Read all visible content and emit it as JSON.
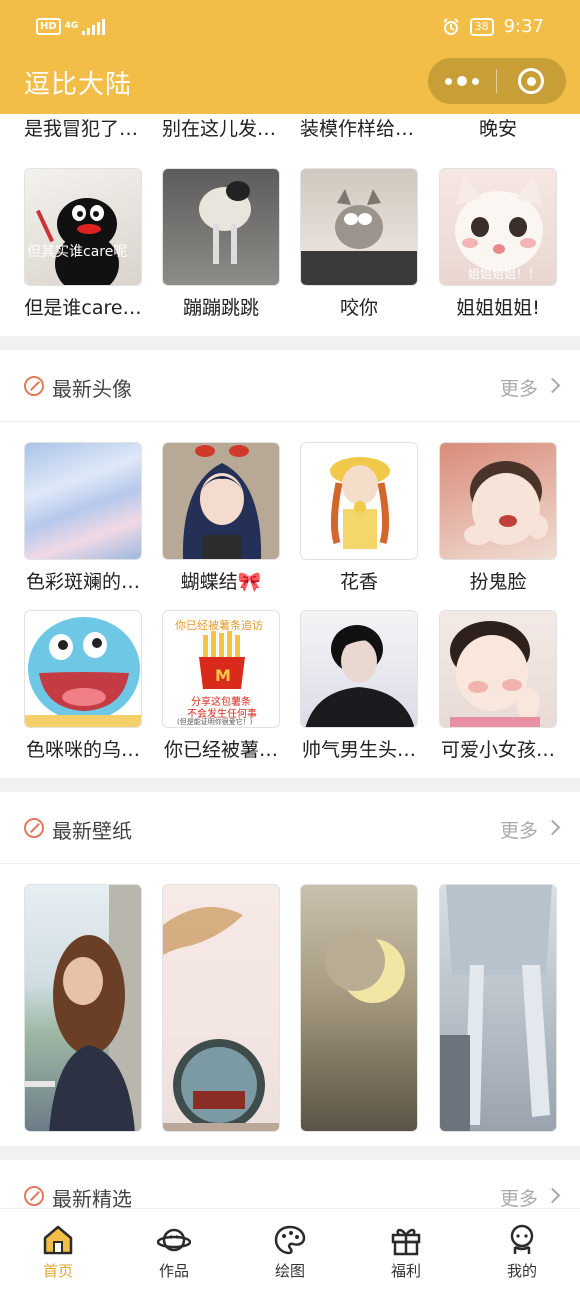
{
  "status_bar": {
    "left": "HD",
    "network": "4G",
    "battery": "38",
    "time": "9:37"
  },
  "header": {
    "title": "逗比大陆"
  },
  "top_partial": {
    "labels": [
      "是我冒犯了…",
      "别在这儿发…",
      "装模作样给…",
      "晚安"
    ]
  },
  "top_grid": {
    "items": [
      {
        "label": "但是谁care…",
        "overlay": "但其实谁care呢"
      },
      {
        "label": "蹦蹦跳跳"
      },
      {
        "label": "咬你"
      },
      {
        "label": "姐姐姐姐!",
        "overlay": "姐姐姐姐！！"
      }
    ]
  },
  "sections": {
    "avatar": {
      "title": "最新头像",
      "more": "更多",
      "items": [
        {
          "label": "色彩斑斓的…"
        },
        {
          "label": "蝴蝶结🎀"
        },
        {
          "label": "花香"
        },
        {
          "label": "扮鬼脸"
        },
        {
          "label": "色咪咪的乌…"
        },
        {
          "label": "你已经被薯…",
          "overlay_top": "你已经被薯条追访",
          "overlay_mid": "分享这包薯条",
          "overlay_mid2": "不会发生任何事",
          "overlay_bottom": "(但是能证明你很爱它！)"
        },
        {
          "label": "帅气男生头…"
        },
        {
          "label": "可爱小女孩…"
        }
      ]
    },
    "wallpaper": {
      "title": "最新壁纸",
      "more": "更多"
    },
    "featured": {
      "title": "最新精选",
      "more": "更多"
    }
  },
  "tabbar": {
    "items": [
      {
        "label": "首页",
        "icon": "home-icon",
        "active": true
      },
      {
        "label": "作品",
        "icon": "planet-icon"
      },
      {
        "label": "绘图",
        "icon": "palette-icon"
      },
      {
        "label": "福利",
        "icon": "gift-icon"
      },
      {
        "label": "我的",
        "icon": "user-icon"
      }
    ]
  },
  "colors": {
    "brand": "#F2BE47",
    "capsule": "#C89F36",
    "active_tab": "#E5A72C",
    "section_icon": "#E37B5B"
  }
}
